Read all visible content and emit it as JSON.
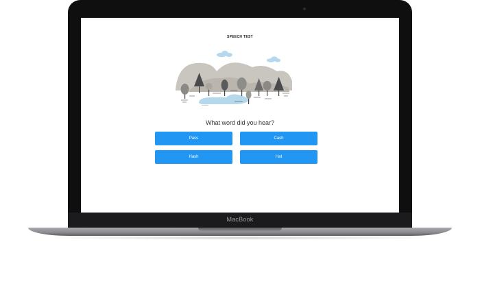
{
  "device": {
    "brand_label": "MacBook"
  },
  "app": {
    "title": "SPEECH TEST",
    "question": "What word did you hear?",
    "answers": [
      {
        "label": "Pass"
      },
      {
        "label": "Cash"
      },
      {
        "label": "Hash"
      },
      {
        "label": "Hat"
      }
    ]
  },
  "colors": {
    "button": "#2196f3",
    "button_text": "#ffffff",
    "bezel": "#0f0f10",
    "water": "#b5d8ec",
    "cloud": "#b5d8ec"
  }
}
